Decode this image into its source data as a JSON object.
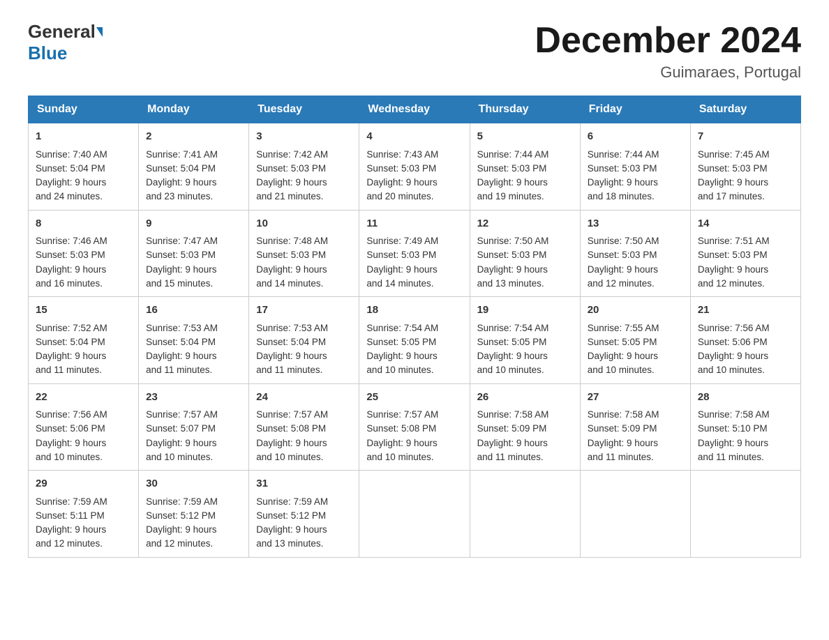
{
  "header": {
    "logo_line1": "General",
    "logo_line2": "Blue",
    "month_title": "December 2024",
    "location": "Guimaraes, Portugal"
  },
  "days_of_week": [
    "Sunday",
    "Monday",
    "Tuesday",
    "Wednesday",
    "Thursday",
    "Friday",
    "Saturday"
  ],
  "weeks": [
    [
      {
        "day": "1",
        "sunrise": "7:40 AM",
        "sunset": "5:04 PM",
        "daylight": "9 hours and 24 minutes."
      },
      {
        "day": "2",
        "sunrise": "7:41 AM",
        "sunset": "5:04 PM",
        "daylight": "9 hours and 23 minutes."
      },
      {
        "day": "3",
        "sunrise": "7:42 AM",
        "sunset": "5:03 PM",
        "daylight": "9 hours and 21 minutes."
      },
      {
        "day": "4",
        "sunrise": "7:43 AM",
        "sunset": "5:03 PM",
        "daylight": "9 hours and 20 minutes."
      },
      {
        "day": "5",
        "sunrise": "7:44 AM",
        "sunset": "5:03 PM",
        "daylight": "9 hours and 19 minutes."
      },
      {
        "day": "6",
        "sunrise": "7:44 AM",
        "sunset": "5:03 PM",
        "daylight": "9 hours and 18 minutes."
      },
      {
        "day": "7",
        "sunrise": "7:45 AM",
        "sunset": "5:03 PM",
        "daylight": "9 hours and 17 minutes."
      }
    ],
    [
      {
        "day": "8",
        "sunrise": "7:46 AM",
        "sunset": "5:03 PM",
        "daylight": "9 hours and 16 minutes."
      },
      {
        "day": "9",
        "sunrise": "7:47 AM",
        "sunset": "5:03 PM",
        "daylight": "9 hours and 15 minutes."
      },
      {
        "day": "10",
        "sunrise": "7:48 AM",
        "sunset": "5:03 PM",
        "daylight": "9 hours and 14 minutes."
      },
      {
        "day": "11",
        "sunrise": "7:49 AM",
        "sunset": "5:03 PM",
        "daylight": "9 hours and 14 minutes."
      },
      {
        "day": "12",
        "sunrise": "7:50 AM",
        "sunset": "5:03 PM",
        "daylight": "9 hours and 13 minutes."
      },
      {
        "day": "13",
        "sunrise": "7:50 AM",
        "sunset": "5:03 PM",
        "daylight": "9 hours and 12 minutes."
      },
      {
        "day": "14",
        "sunrise": "7:51 AM",
        "sunset": "5:03 PM",
        "daylight": "9 hours and 12 minutes."
      }
    ],
    [
      {
        "day": "15",
        "sunrise": "7:52 AM",
        "sunset": "5:04 PM",
        "daylight": "9 hours and 11 minutes."
      },
      {
        "day": "16",
        "sunrise": "7:53 AM",
        "sunset": "5:04 PM",
        "daylight": "9 hours and 11 minutes."
      },
      {
        "day": "17",
        "sunrise": "7:53 AM",
        "sunset": "5:04 PM",
        "daylight": "9 hours and 11 minutes."
      },
      {
        "day": "18",
        "sunrise": "7:54 AM",
        "sunset": "5:05 PM",
        "daylight": "9 hours and 10 minutes."
      },
      {
        "day": "19",
        "sunrise": "7:54 AM",
        "sunset": "5:05 PM",
        "daylight": "9 hours and 10 minutes."
      },
      {
        "day": "20",
        "sunrise": "7:55 AM",
        "sunset": "5:05 PM",
        "daylight": "9 hours and 10 minutes."
      },
      {
        "day": "21",
        "sunrise": "7:56 AM",
        "sunset": "5:06 PM",
        "daylight": "9 hours and 10 minutes."
      }
    ],
    [
      {
        "day": "22",
        "sunrise": "7:56 AM",
        "sunset": "5:06 PM",
        "daylight": "9 hours and 10 minutes."
      },
      {
        "day": "23",
        "sunrise": "7:57 AM",
        "sunset": "5:07 PM",
        "daylight": "9 hours and 10 minutes."
      },
      {
        "day": "24",
        "sunrise": "7:57 AM",
        "sunset": "5:08 PM",
        "daylight": "9 hours and 10 minutes."
      },
      {
        "day": "25",
        "sunrise": "7:57 AM",
        "sunset": "5:08 PM",
        "daylight": "9 hours and 10 minutes."
      },
      {
        "day": "26",
        "sunrise": "7:58 AM",
        "sunset": "5:09 PM",
        "daylight": "9 hours and 11 minutes."
      },
      {
        "day": "27",
        "sunrise": "7:58 AM",
        "sunset": "5:09 PM",
        "daylight": "9 hours and 11 minutes."
      },
      {
        "day": "28",
        "sunrise": "7:58 AM",
        "sunset": "5:10 PM",
        "daylight": "9 hours and 11 minutes."
      }
    ],
    [
      {
        "day": "29",
        "sunrise": "7:59 AM",
        "sunset": "5:11 PM",
        "daylight": "9 hours and 12 minutes."
      },
      {
        "day": "30",
        "sunrise": "7:59 AM",
        "sunset": "5:12 PM",
        "daylight": "9 hours and 12 minutes."
      },
      {
        "day": "31",
        "sunrise": "7:59 AM",
        "sunset": "5:12 PM",
        "daylight": "9 hours and 13 minutes."
      },
      null,
      null,
      null,
      null
    ]
  ],
  "labels": {
    "sunrise": "Sunrise:",
    "sunset": "Sunset:",
    "daylight": "Daylight:"
  }
}
